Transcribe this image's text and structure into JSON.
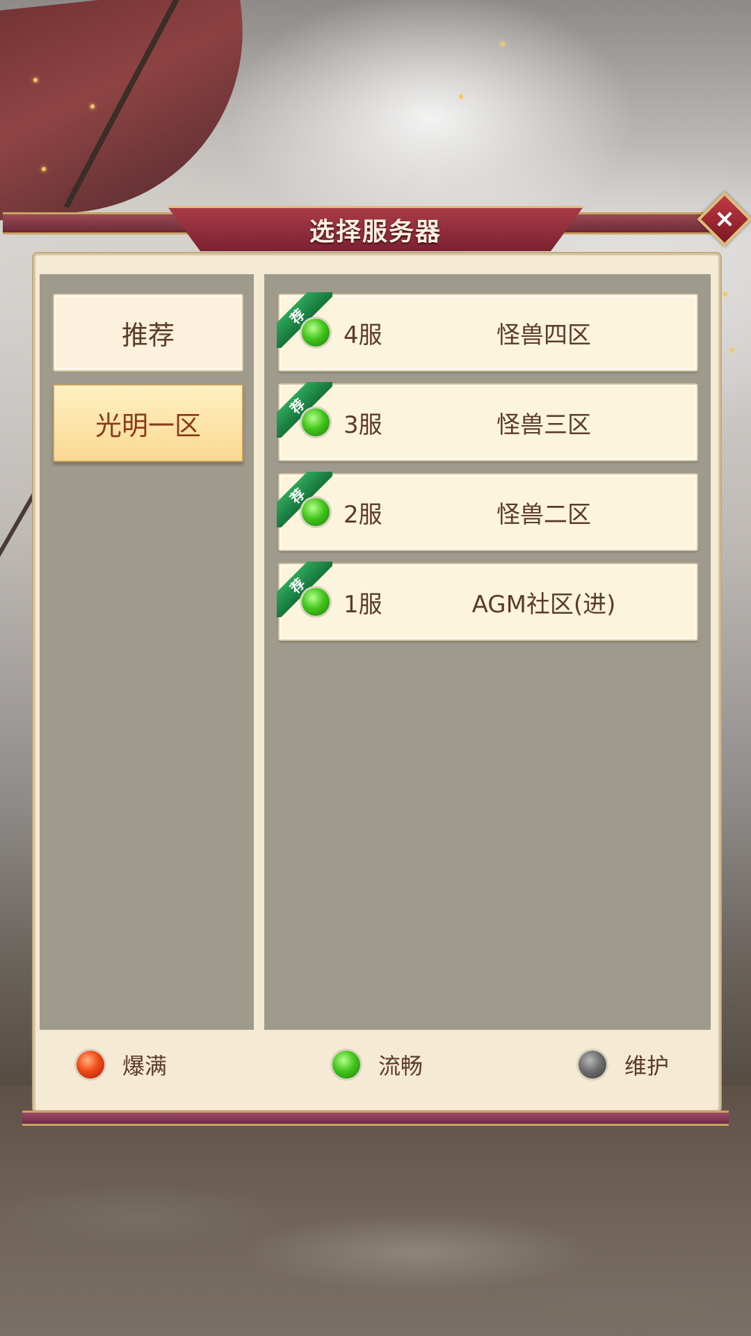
{
  "dialog": {
    "title": "选择服务器",
    "close_icon": "close-icon"
  },
  "tabs": [
    {
      "label": "推荐",
      "active": false
    },
    {
      "label": "光明一区",
      "active": true
    }
  ],
  "servers": [
    {
      "badge": "荐",
      "number": "4服",
      "name": "怪兽四区",
      "status": "green"
    },
    {
      "badge": "荐",
      "number": "3服",
      "name": "怪兽三区",
      "status": "green"
    },
    {
      "badge": "荐",
      "number": "2服",
      "name": "怪兽二区",
      "status": "green"
    },
    {
      "badge": "荐",
      "number": "1服",
      "name": "AGM社区(进)",
      "status": "green"
    }
  ],
  "legend": [
    {
      "label": "爆满",
      "color": "#f04a16"
    },
    {
      "label": "流畅",
      "color": "#42c51c"
    },
    {
      "label": "维护",
      "color": "#6e6e6e"
    }
  ]
}
